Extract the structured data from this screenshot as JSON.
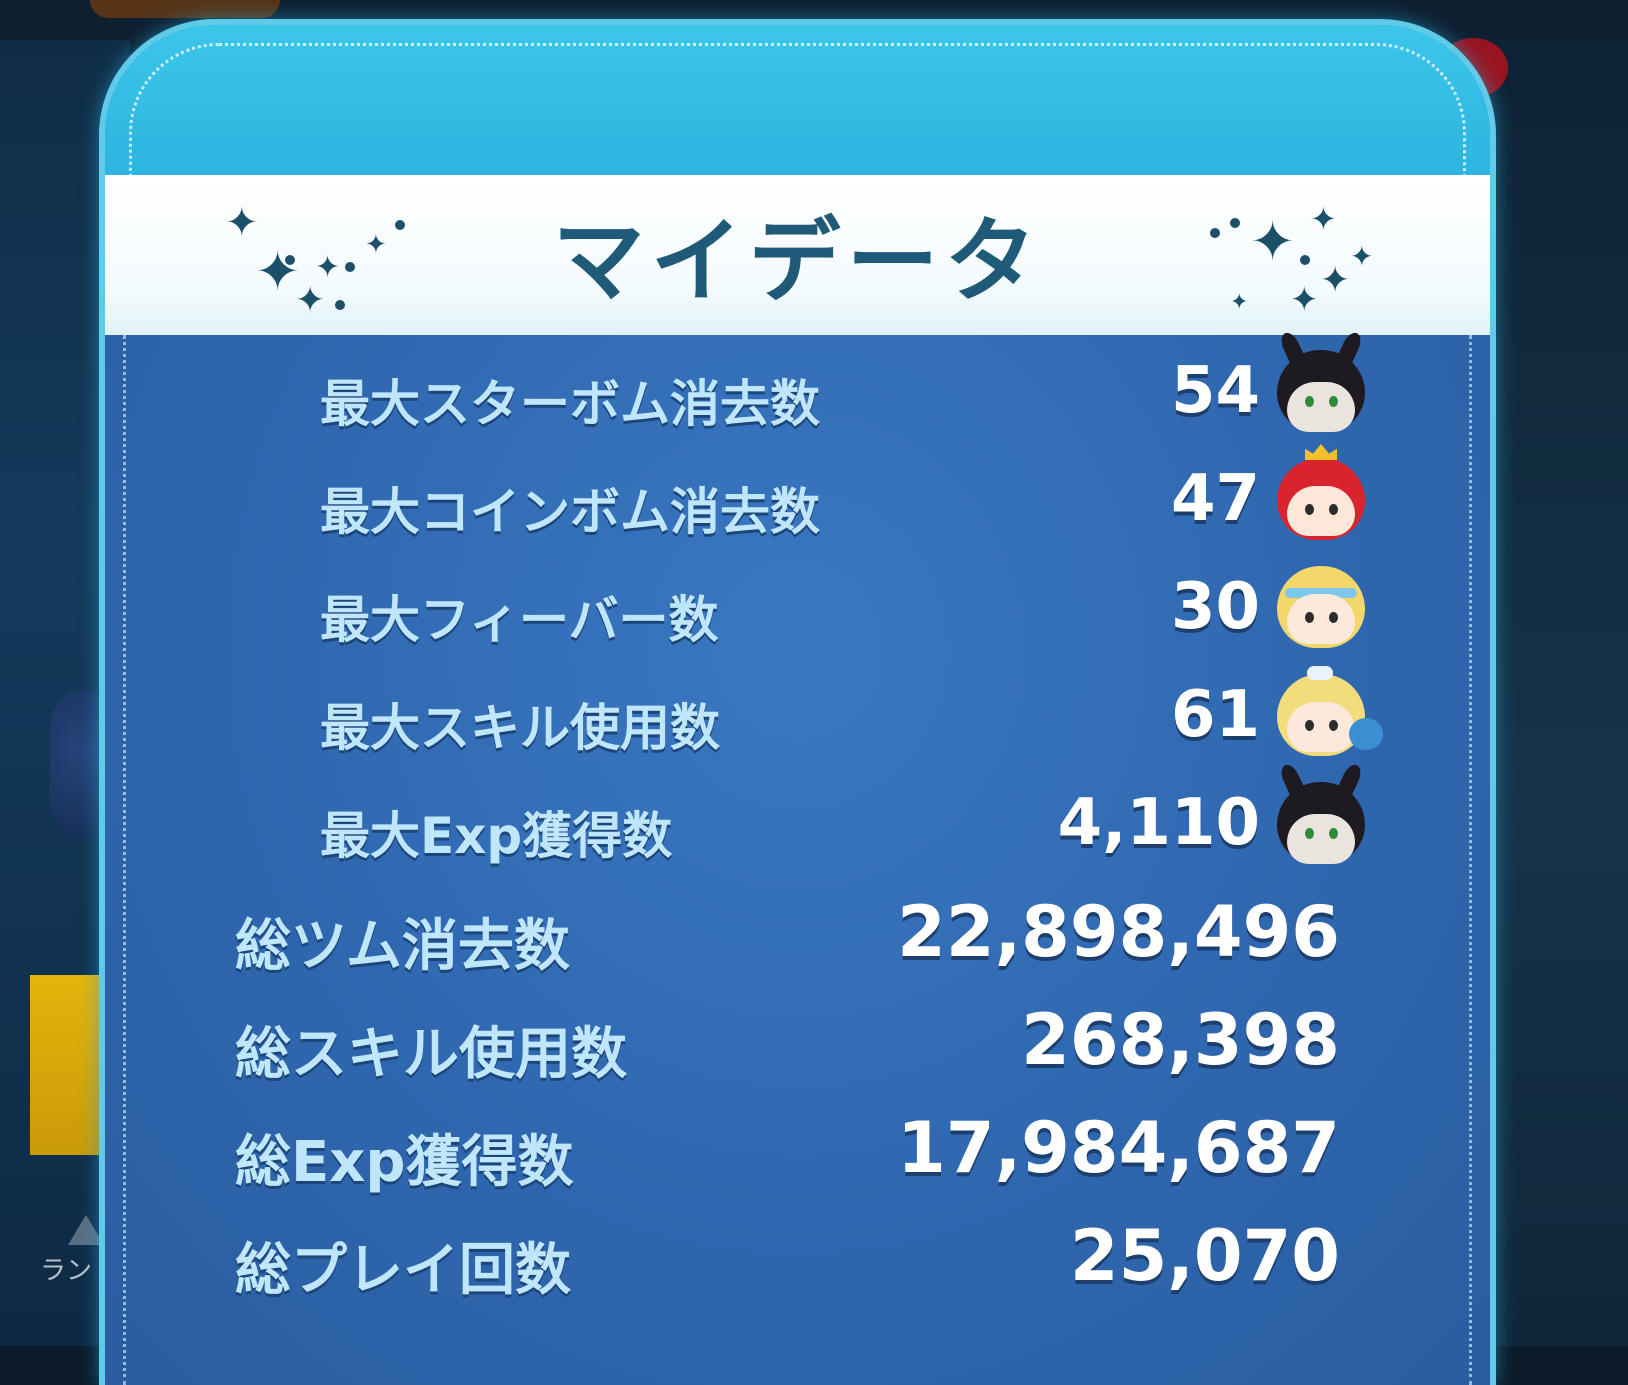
{
  "dialog": {
    "title": "マイデータ"
  },
  "stats": {
    "max": [
      {
        "label": "最大スターボム消去数",
        "value": "54",
        "tsum_icon": "maleficent-tsum-icon"
      },
      {
        "label": "最大コインボム消去数",
        "value": "47",
        "tsum_icon": "ariel-tsum-icon"
      },
      {
        "label": "最大フィーバー数",
        "value": "30",
        "tsum_icon": "cinderella-tsum-icon"
      },
      {
        "label": "最大スキル使用数",
        "value": "61",
        "tsum_icon": "cinderella-bird-tsum-icon"
      },
      {
        "label": "最大Exp獲得数",
        "value": "4,110",
        "tsum_icon": "maleficent-tsum-icon"
      }
    ],
    "totals": [
      {
        "label": "総ツム消去数",
        "value": "22,898,496"
      },
      {
        "label": "総スキル使用数",
        "value": "268,398"
      },
      {
        "label": "総Exp獲得数",
        "value": "17,984,687"
      },
      {
        "label": "総プレイ回数",
        "value": "25,070"
      }
    ]
  },
  "background": {
    "ranking_label": "ラン"
  },
  "colors": {
    "panel_blue": "#2f6ab3",
    "header_cyan": "#3cc6ea",
    "title_text": "#1f5a78",
    "label_text": "#bfe6fa",
    "value_text": "#ffffff"
  }
}
